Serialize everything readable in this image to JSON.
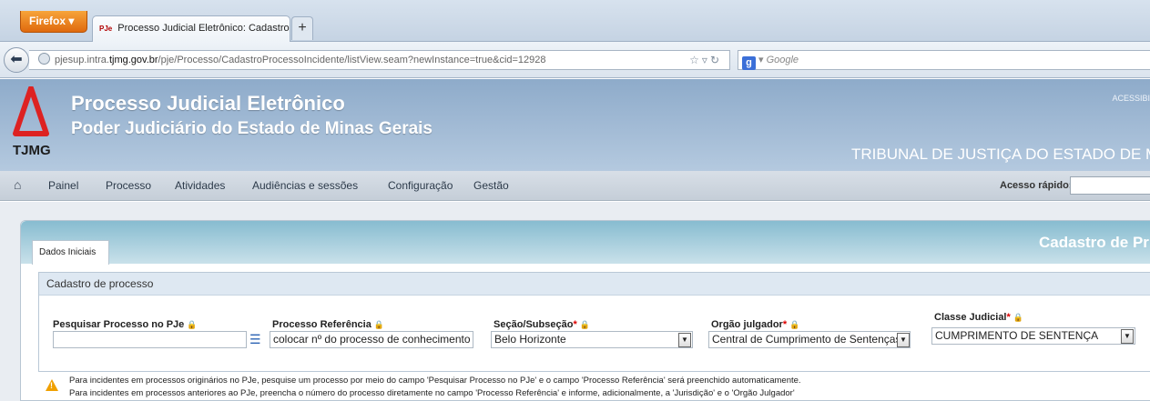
{
  "browser": {
    "menu_button": "Firefox",
    "tab": {
      "favicon": "PJe",
      "title": "Processo Judicial Eletrônico: Cadastro de..."
    },
    "newtab_label": "+",
    "url": {
      "prefix": "pjesup.intra.",
      "host": "tjmg.gov.br",
      "path": "/pje/Processo/CadastroProcessoIncidente/listView.seam?newInstance=true&cid=12928"
    },
    "search_placeholder": "Google"
  },
  "header": {
    "logo_text": "TJMG",
    "title": "Processo Judicial Eletrônico",
    "subtitle": "Poder Judiciário do Estado de Minas Gerais",
    "acessibilidade": "ACESSIBI",
    "tribunal": "TRIBUNAL DE JUSTIÇA DO ESTADO DE MINAS"
  },
  "menu": {
    "items": [
      "Painel",
      "Processo",
      "Atividades",
      "Audiências e sessões",
      "Configuração",
      "Gestão"
    ],
    "acesso_rapido_label": "Acesso rápido:"
  },
  "panel": {
    "tab_label": "Dados Iniciais",
    "title": "Cadastro de Pr",
    "section_title": "Cadastro de processo",
    "fields": {
      "pesquisar": {
        "label": "Pesquisar Processo no PJe",
        "value": ""
      },
      "referencia": {
        "label": "Processo Referência",
        "value": "colocar nº do processo de conhecimento"
      },
      "secao": {
        "label": "Seção/Subseção",
        "value": "Belo Horizonte"
      },
      "orgao": {
        "label": "Orgão julgador",
        "value": "Central de Cumprimento de Sentenças - C"
      },
      "classe": {
        "label": "Classe Judicial",
        "value": "CUMPRIMENTO DE SENTENÇA"
      }
    },
    "required_mark": "*",
    "warnings": [
      "Para incidentes em processos originários no PJe, pesquise um processo por meio do campo 'Pesquisar Processo no PJe' e o campo 'Processo Referência' será preenchido automaticamente.",
      "Para incidentes em processos anteriores ao PJe, preencha o número do processo diretamente no campo 'Processo Referência' e informe, adicionalmente, a 'Jurisdição' e o 'Orgão Julgador'"
    ]
  }
}
